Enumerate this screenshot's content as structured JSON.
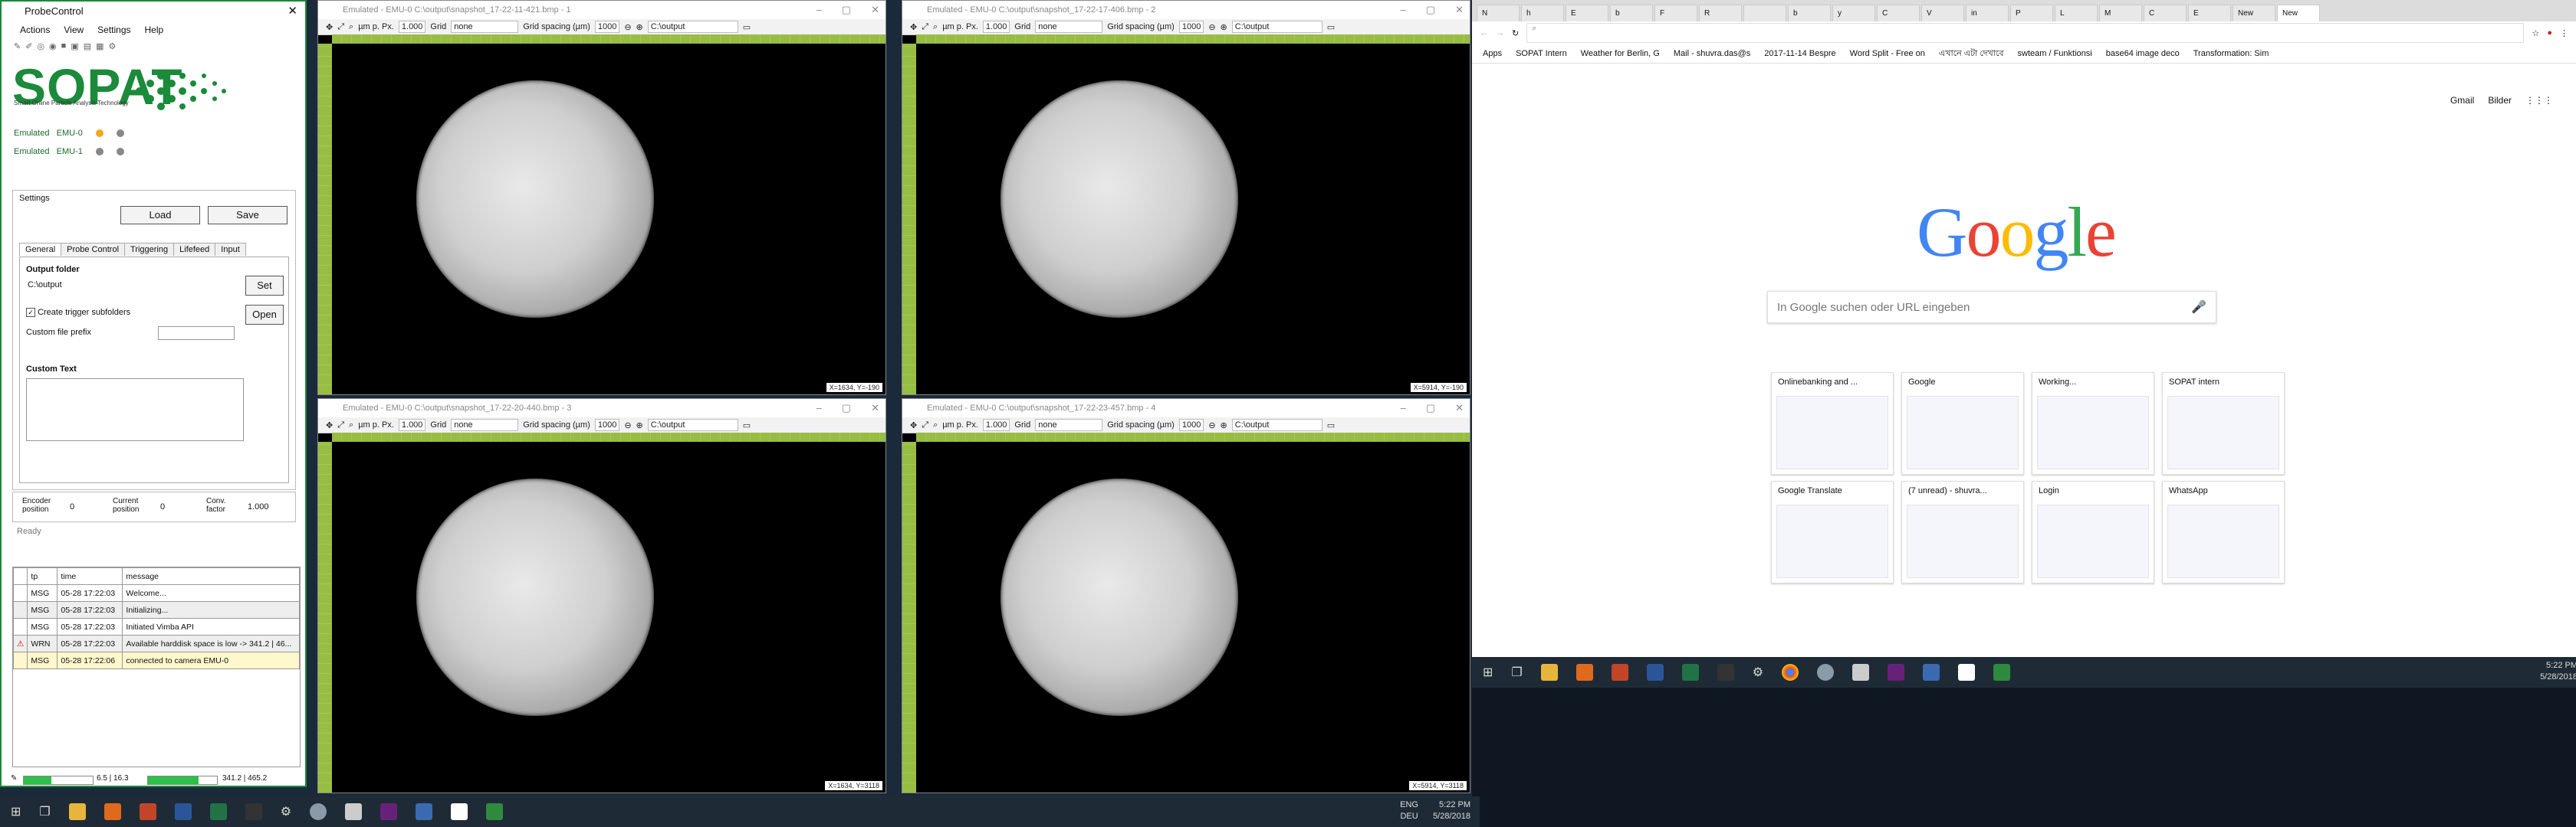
{
  "probe": {
    "title": "ProbeControl",
    "menu": [
      "Actions",
      "View",
      "Settings",
      "Help"
    ],
    "logo": "SOPAT",
    "logo_sub": "Smart Online Particle Analysis Technology",
    "cameras": [
      {
        "label": "Emulated",
        "id": "EMU-0",
        "led": "#f5a623"
      },
      {
        "label": "Emulated",
        "id": "EMU-1",
        "led": "#888888"
      }
    ],
    "settings_label": "Settings",
    "load": "Load",
    "save": "Save",
    "tabs": [
      "General",
      "Probe Control",
      "Triggering",
      "Lifefeed",
      "Input"
    ],
    "output_folder_label": "Output folder",
    "output_folder": "C:\\output",
    "set": "Set",
    "create_trigger": "Create trigger subfolders",
    "open": "Open",
    "custom_prefix": "Custom file prefix",
    "custom_text": "Custom Text",
    "encoder_label": "Encoder position",
    "encoder_val": "0",
    "current_label": "Current position",
    "current_val": "0",
    "conv_label": "Conv. factor",
    "conv_val": "1.000",
    "status": "Ready",
    "log_headers": [
      "tp",
      "time",
      "message"
    ],
    "log": [
      {
        "tp": "MSG",
        "time": "05-28 17:22:03",
        "message": "Welcome..."
      },
      {
        "tp": "MSG",
        "time": "05-28 17:22:03",
        "message": "Initializing..."
      },
      {
        "tp": "MSG",
        "time": "05-28 17:22:03",
        "message": "Initiated Vimba API"
      },
      {
        "tp": "WRN",
        "time": "05-28 17:22:03",
        "message": "Available harddisk space is low -> 341.2 | 46..."
      },
      {
        "tp": "MSG",
        "time": "05-28 17:22:06",
        "message": "connected to camera EMU-0"
      }
    ],
    "bar1": "6.5 | 16.3",
    "bar1_fill": 0.4,
    "bar2": "341.2 | 465.2",
    "bar2_fill": 0.73
  },
  "viewers": [
    {
      "title": "Emulated - EMU-0 C:\\output\\snapshot_17-22-11-421.bmp - 1",
      "coord": "X=1634, Y=-190"
    },
    {
      "title": "Emulated - EMU-0 C:\\output\\snapshot_17-22-17-406.bmp - 2",
      "coord": "X=5914, Y=-190"
    },
    {
      "title": "Emulated - EMU-0 C:\\output\\snapshot_17-22-20-440.bmp - 3",
      "coord": "X=1634, Y=3118"
    },
    {
      "title": "Emulated - EMU-0 C:\\output\\snapshot_17-22-23-457.bmp - 4",
      "coord": "X=5914, Y=3118"
    }
  ],
  "viewer_toolbar": {
    "unit": "µm p. Px.",
    "unit_val": "1.000",
    "grid": "Grid",
    "grid_val": "none",
    "spacing": "Grid spacing (µm)",
    "spacing_val": "1000",
    "path": "C:\\output"
  },
  "browser": {
    "tabs": [
      "N",
      "h",
      "E",
      "b",
      "F",
      "R",
      "",
      "b",
      "y",
      "C",
      "V",
      "in",
      "P",
      "L",
      "M",
      "C",
      "E",
      "New",
      "New"
    ],
    "bookmarks": [
      "Apps",
      "SOPAT Intern",
      "Weather for Berlin, G",
      "Mail - shuvra.das@s",
      "2017-11-14 Bespre",
      "Word Split - Free on",
      "এখানে এটা দেখাবে",
      "swteam / Funktionsi",
      "base64 image deco",
      "Transformation: Sim"
    ],
    "links": [
      "Gmail",
      "Bilder"
    ],
    "google": "Google",
    "search_placeholder": "In Google suchen oder URL eingeben",
    "tiles": [
      "Onlinebanking and ...",
      "Google",
      "Working...",
      "SOPAT intern",
      "Google Translate",
      "(7 unread) - shuvra...",
      "Login",
      "WhatsApp"
    ]
  },
  "taskbar": {
    "lang": "ENG",
    "region": "DEU",
    "time": "5:22 PM",
    "date": "5/28/2018"
  }
}
